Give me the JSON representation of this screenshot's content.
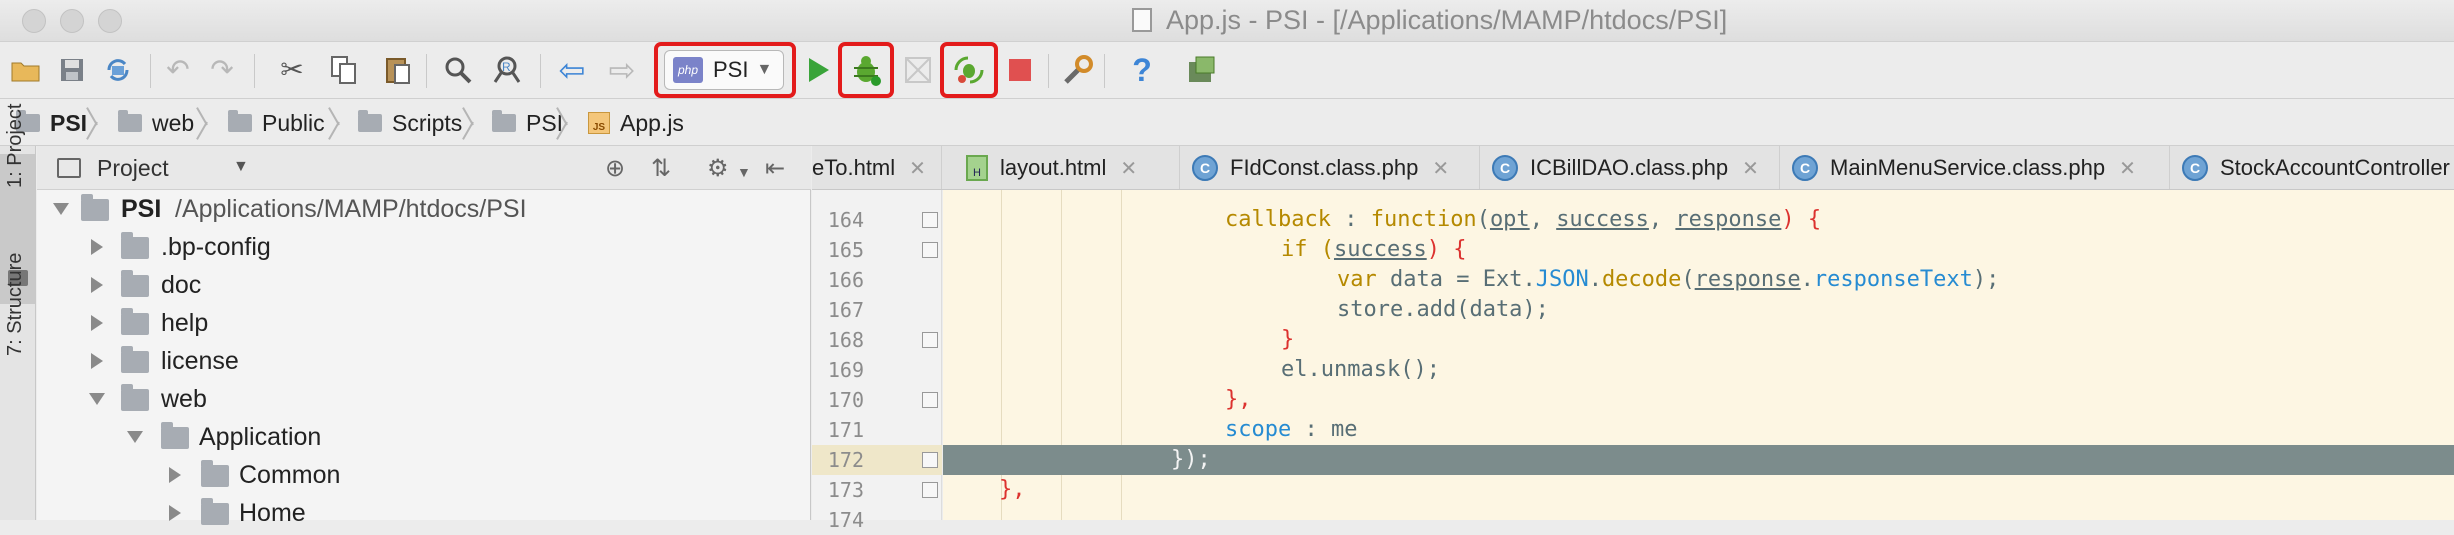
{
  "window": {
    "title": "App.js - PSI - [/Applications/MAMP/htdocs/PSI]"
  },
  "toolbar": {
    "run_config_label": "PSI",
    "run_config_icon": "php",
    "buttons": [
      "open-icon",
      "save-icon",
      "sync-icon",
      "undo-icon",
      "redo-icon",
      "cut-icon",
      "copy-icon",
      "paste-icon",
      "find-icon",
      "replace-icon",
      "back-icon",
      "forward-icon",
      "run-icon",
      "debug-icon",
      "coverage-icon",
      "listen-debug-icon",
      "stop-icon",
      "settings-icon",
      "help-icon",
      "sdk-icon"
    ]
  },
  "breadcrumb": {
    "items": [
      "PSI",
      "web",
      "Public",
      "Scripts",
      "PSI",
      "App.js"
    ],
    "file_icon": "JS"
  },
  "toolstrip": {
    "project_tab": "1: Project",
    "structure_tab": "7: Structure"
  },
  "project": {
    "title": "Project",
    "root_name": "PSI",
    "root_path": "/Applications/MAMP/htdocs/PSI",
    "items": [
      ".bp-config",
      "doc",
      "help",
      "license",
      "web",
      "Application",
      "Common",
      "Home"
    ]
  },
  "editor": {
    "tabs": [
      {
        "label": "eTo.html",
        "icon": "html"
      },
      {
        "label": "layout.html",
        "icon": "H"
      },
      {
        "label": "FIdConst.class.php",
        "icon": "C"
      },
      {
        "label": "ICBillDAO.class.php",
        "icon": "C"
      },
      {
        "label": "MainMenuService.class.php",
        "icon": "C"
      },
      {
        "label": "StockAccountController",
        "icon": "C"
      }
    ],
    "line_numbers": [
      "164",
      "165",
      "166",
      "167",
      "168",
      "169",
      "170",
      "171",
      "172",
      "173",
      "174"
    ],
    "highlighted_line": "172",
    "code": {
      "l164_kw": "callback",
      "l164_a": " : ",
      "l164_fn": "function",
      "l164_b": "(",
      "l164_p1": "opt",
      "l164_c": ", ",
      "l164_p2": "success",
      "l164_d": ", ",
      "l164_p3": "response",
      "l164_e": ") {",
      "l165_a": "if (",
      "l165_p": "success",
      "l165_b": ") {",
      "l166_kw": "var",
      "l166_a": " data = Ext.",
      "l166_json": "JSON",
      "l166_b": ".",
      "l166_dec": "decode",
      "l166_c": "(",
      "l166_p": "response",
      "l166_d": ".",
      "l166_rt": "responseText",
      "l166_e": ");",
      "l167": "store.add(data);",
      "l168": "}",
      "l169": "el.unmask();",
      "l170": "},",
      "l171_kw": "scope",
      "l171_a": " : me",
      "l172": "});",
      "l173": "},"
    }
  },
  "colors": {
    "highlight_box": "#e31b1b",
    "editor_bg": "#fdf6e3",
    "current_line": "#7c8c8c"
  }
}
